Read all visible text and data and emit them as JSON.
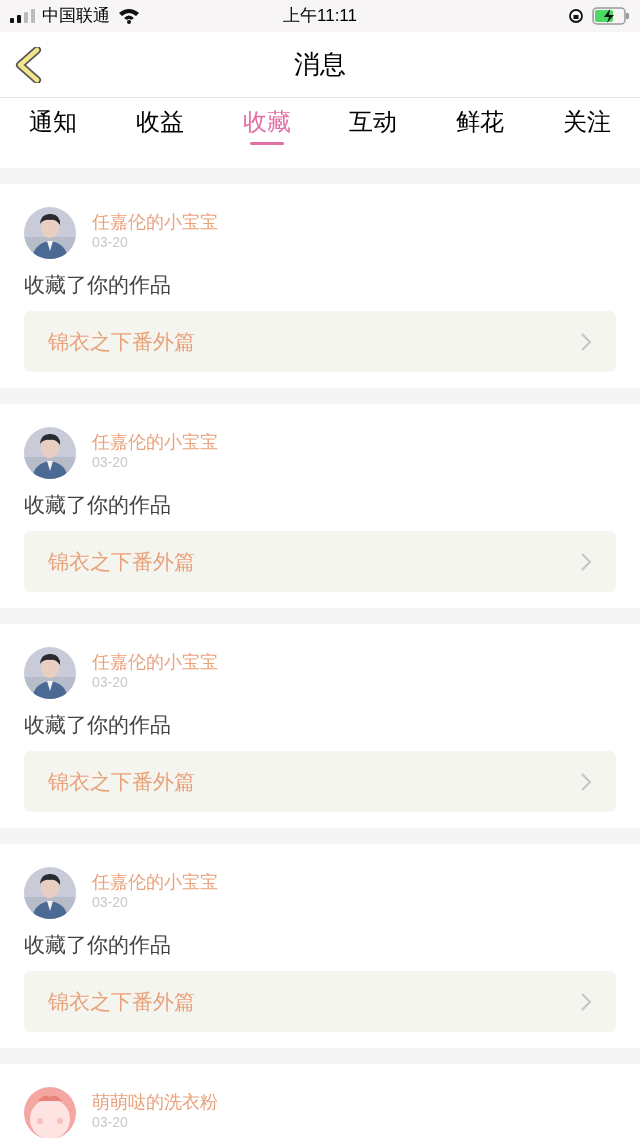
{
  "status_bar": {
    "carrier": "中国联通",
    "time": "上午11:11"
  },
  "header": {
    "title": "消息"
  },
  "tabs": [
    {
      "label": "通知",
      "selected": false
    },
    {
      "label": "收益",
      "selected": false
    },
    {
      "label": "收藏",
      "selected": true
    },
    {
      "label": "互动",
      "selected": false
    },
    {
      "label": "鲜花",
      "selected": false
    },
    {
      "label": "关注",
      "selected": false
    }
  ],
  "messages": [
    {
      "user": "任嘉伦的小宝宝",
      "date": "03-20",
      "action": "收藏了你的作品",
      "work": "锦衣之下番外篇"
    },
    {
      "user": "任嘉伦的小宝宝",
      "date": "03-20",
      "action": "收藏了你的作品",
      "work": "锦衣之下番外篇"
    },
    {
      "user": "任嘉伦的小宝宝",
      "date": "03-20",
      "action": "收藏了你的作品",
      "work": "锦衣之下番外篇"
    },
    {
      "user": "任嘉伦的小宝宝",
      "date": "03-20",
      "action": "收藏了你的作品",
      "work": "锦衣之下番外篇"
    },
    {
      "avatar": {
        "kind": "cartoon"
      },
      "user": "萌萌哒的洗衣粉",
      "date": "03-20"
    }
  ]
}
